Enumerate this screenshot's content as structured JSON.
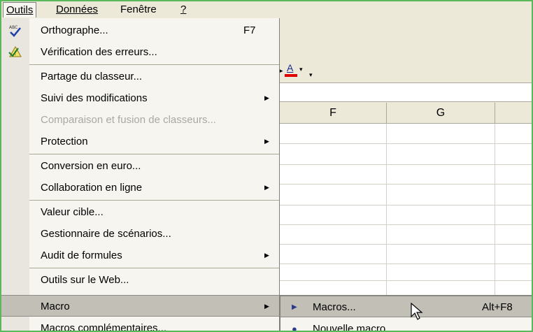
{
  "menubar": {
    "items": [
      {
        "label": "Outils"
      },
      {
        "label": "Données"
      },
      {
        "label": "Fenêtre"
      },
      {
        "label": "?"
      }
    ]
  },
  "toolbar": {
    "font_color_letter": "A"
  },
  "grid": {
    "columns": [
      "F",
      "G"
    ]
  },
  "menu": {
    "items": [
      {
        "label": "Orthographe...",
        "shortcut": "F7",
        "icon": "spelling-check-icon"
      },
      {
        "label": "Vérification des erreurs...",
        "icon": "error-check-icon"
      },
      {
        "label": "Partage du classeur..."
      },
      {
        "label": "Suivi des modifications",
        "submenu": true
      },
      {
        "label": "Comparaison et fusion de classeurs...",
        "disabled": true
      },
      {
        "label": "Protection",
        "submenu": true
      },
      {
        "label": "Conversion en euro..."
      },
      {
        "label": "Collaboration en ligne",
        "submenu": true
      },
      {
        "label": "Valeur cible..."
      },
      {
        "label": "Gestionnaire de scénarios..."
      },
      {
        "label": "Audit de formules",
        "submenu": true
      },
      {
        "label": "Outils sur le Web..."
      },
      {
        "label": "Macro",
        "submenu": true,
        "highlighted": true
      },
      {
        "label": "Macros complémentaires..."
      }
    ]
  },
  "submenu": {
    "items": [
      {
        "label": "Macros...",
        "shortcut": "Alt+F8",
        "icon": "play-macro-icon",
        "highlighted": true
      },
      {
        "label": "Nouvelle macro...",
        "icon": "record-macro-icon"
      }
    ]
  },
  "colors": {
    "menu_bg": "#f6f5f0",
    "highlight": "#c1bfb6",
    "frame": "#5ab75a",
    "font_color": "#e00000"
  }
}
